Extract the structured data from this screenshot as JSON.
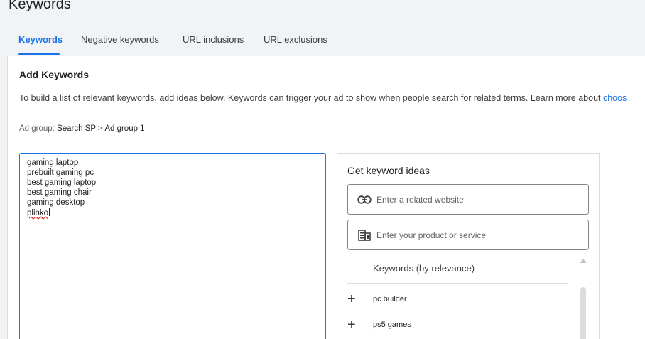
{
  "page": {
    "title": "Keywords"
  },
  "tabs": [
    {
      "label": "Keywords",
      "active": true
    },
    {
      "label": "Negative keywords",
      "active": false
    },
    {
      "label": "URL inclusions",
      "active": false
    },
    {
      "label": "URL exclusions",
      "active": false
    }
  ],
  "add_keywords": {
    "title": "Add Keywords",
    "description": "To build a list of relevant keywords, add ideas below. Keywords can trigger your ad to show when people search for related terms. Learn more about ",
    "link_text": "choos",
    "ad_group_label": "Ad group:",
    "ad_group_value": "Search SP > Ad group 1"
  },
  "keywords_text": [
    "gaming laptop",
    "prebuilt gaming pc",
    "best gaming laptop",
    "best gaming chair",
    "gaming desktop",
    "plinko"
  ],
  "keyword_ideas": {
    "title": "Get keyword ideas",
    "website_placeholder": "Enter a related website",
    "product_placeholder": "Enter your product or service",
    "list_header": "Keywords (by relevance)",
    "items": [
      "pc builder",
      "ps5 games"
    ],
    "icons": {
      "website": "link-icon",
      "product": "building-icon",
      "add": "plus-icon"
    }
  },
  "colors": {
    "accent": "#1a73e8",
    "border": "#dadce0",
    "error_underline": "#d93025"
  }
}
